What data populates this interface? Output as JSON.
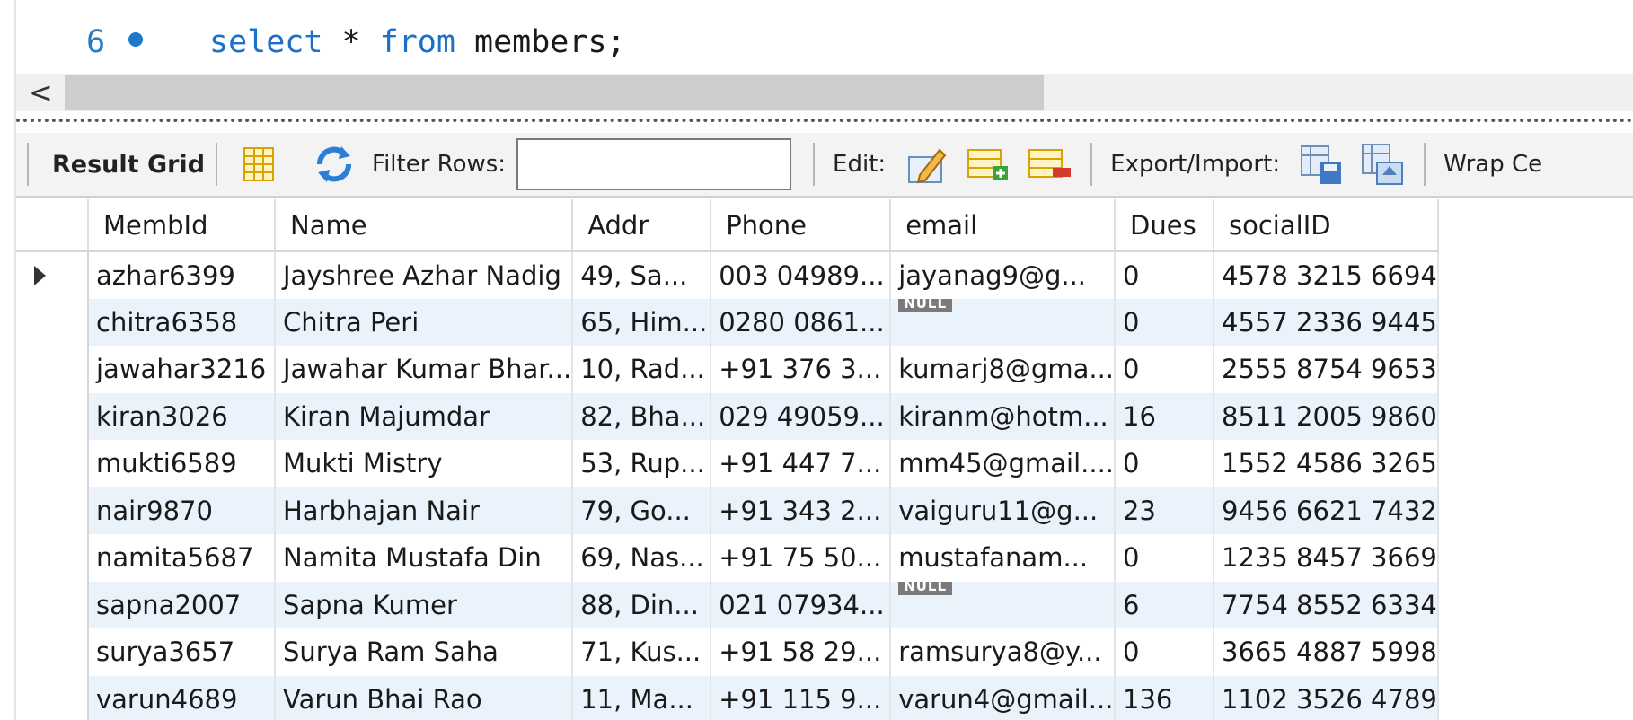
{
  "editor": {
    "line_number": "6",
    "keyword_select": "select",
    "star": " * ",
    "keyword_from": "from",
    "table_name": " members;"
  },
  "scrollbar": {
    "left_arrow": "<"
  },
  "toolbar": {
    "result_grid_label": "Result Grid",
    "filter_label": "Filter Rows:",
    "filter_value": "",
    "edit_label": "Edit:",
    "export_label": "Export/Import:",
    "wrap_label": "Wrap Ce",
    "icons": [
      "grid-form-icon",
      "refresh-icon",
      "edit-pencil-icon",
      "add-row-icon",
      "delete-row-icon",
      "export-icon",
      "import-icon"
    ]
  },
  "grid": {
    "columns": [
      "MembId",
      "Name",
      "Addr",
      "Phone",
      "email",
      "Dues",
      "socialID"
    ],
    "null_label": "NULL",
    "rows": [
      [
        "azhar6399",
        "Jayshree Azhar Nadig",
        "49, Sa...",
        "003 04989...",
        "jayanag9@g...",
        "0",
        "4578 3215 6694"
      ],
      [
        "chitra6358",
        "Chitra Peri",
        "65, Him...",
        "0280 0861...",
        null,
        "0",
        "4557 2336 9445"
      ],
      [
        "jawahar3216",
        "Jawahar Kumar Bhar...",
        "10, Rad...",
        "+91 376 3...",
        "kumarj8@gma...",
        "0",
        "2555 8754 9653"
      ],
      [
        "kiran3026",
        "Kiran Majumdar",
        "82, Bha...",
        "029 49059...",
        "kiranm@hotm...",
        "16",
        "8511 2005 9860"
      ],
      [
        "mukti6589",
        "Mukti Mistry",
        "53, Rup...",
        "+91 447 7...",
        "mm45@gmail....",
        "0",
        "1552 4586 3265"
      ],
      [
        "nair9870",
        "Harbhajan Nair",
        "79, Go...",
        "+91 343 2...",
        "vaiguru11@g...",
        "23",
        "9456 6621 7432"
      ],
      [
        "namita5687",
        "Namita Mustafa Din",
        "69, Nas...",
        "+91 75 50...",
        "mustafanam...",
        "0",
        "1235 8457 3669"
      ],
      [
        "sapna2007",
        "Sapna Kumer",
        "88, Din...",
        "021 07934...",
        null,
        "6",
        "7754 8552 6334"
      ],
      [
        "surya3657",
        "Surya Ram Saha",
        "71, Kus...",
        "+91 58 29...",
        "ramsurya8@y...",
        "0",
        "3665 4887 5998"
      ],
      [
        "varun4689",
        "Varun Bhai Rao",
        "11, Ma...",
        "+91 115 9...",
        "varun4@gmail...",
        "136",
        "1102 3526 4789"
      ]
    ]
  },
  "colors": {
    "keyword": "#1e6fc6",
    "alt_row": "#eaf2fb",
    "null_badge": "#7a7a7a"
  }
}
